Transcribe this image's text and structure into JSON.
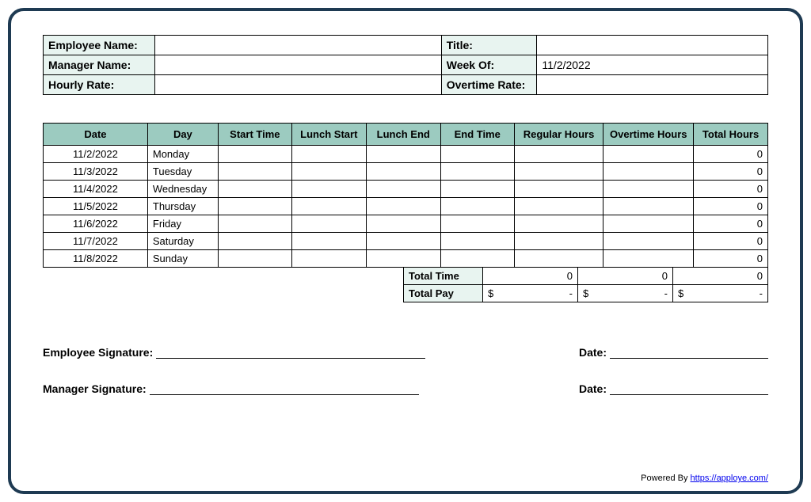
{
  "header": {
    "employee_name_label": "Employee Name:",
    "employee_name_value": "",
    "title_label": "Title:",
    "title_value": "",
    "manager_name_label": "Manager Name:",
    "manager_name_value": "",
    "week_of_label": "Week Of:",
    "week_of_value": "11/2/2022",
    "hourly_rate_label": "Hourly Rate:",
    "hourly_rate_value": "",
    "overtime_rate_label": "Overtime Rate:",
    "overtime_rate_value": ""
  },
  "columns": {
    "date": "Date",
    "day": "Day",
    "start_time": "Start Time",
    "lunch_start": "Lunch Start",
    "lunch_end": "Lunch End",
    "end_time": "End Time",
    "regular_hours": "Regular Hours",
    "overtime_hours": "Overtime Hours",
    "total_hours": "Total Hours"
  },
  "rows": [
    {
      "date": "11/2/2022",
      "day": "Monday",
      "start": "",
      "lunch_start": "",
      "lunch_end": "",
      "end": "",
      "regular": "",
      "overtime": "",
      "total": "0"
    },
    {
      "date": "11/3/2022",
      "day": "Tuesday",
      "start": "",
      "lunch_start": "",
      "lunch_end": "",
      "end": "",
      "regular": "",
      "overtime": "",
      "total": "0"
    },
    {
      "date": "11/4/2022",
      "day": "Wednesday",
      "start": "",
      "lunch_start": "",
      "lunch_end": "",
      "end": "",
      "regular": "",
      "overtime": "",
      "total": "0"
    },
    {
      "date": "11/5/2022",
      "day": "Thursday",
      "start": "",
      "lunch_start": "",
      "lunch_end": "",
      "end": "",
      "regular": "",
      "overtime": "",
      "total": "0"
    },
    {
      "date": "11/6/2022",
      "day": "Friday",
      "start": "",
      "lunch_start": "",
      "lunch_end": "",
      "end": "",
      "regular": "",
      "overtime": "",
      "total": "0"
    },
    {
      "date": "11/7/2022",
      "day": "Saturday",
      "start": "",
      "lunch_start": "",
      "lunch_end": "",
      "end": "",
      "regular": "",
      "overtime": "",
      "total": "0"
    },
    {
      "date": "11/8/2022",
      "day": "Sunday",
      "start": "",
      "lunch_start": "",
      "lunch_end": "",
      "end": "",
      "regular": "",
      "overtime": "",
      "total": "0"
    }
  ],
  "totals": {
    "total_time_label": "Total Time",
    "total_time_regular": "0",
    "total_time_overtime": "0",
    "total_time_total": "0",
    "total_pay_label": "Total Pay",
    "currency": "$",
    "dash": "-"
  },
  "signatures": {
    "employee_label": "Employee Signature:",
    "manager_label": "Manager Signature:",
    "date_label": "Date:"
  },
  "footer": {
    "powered_by": "Powered By ",
    "link_text": "https://apploye.com/"
  }
}
